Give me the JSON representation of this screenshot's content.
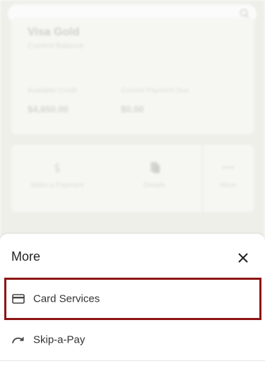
{
  "background": {
    "search": {
      "icon": "search-icon"
    },
    "account_card": {
      "name": "Visa Gold",
      "subtitle": "Current Balance",
      "available_credit_label": "Available Credit",
      "available_credit_value": "$4,650.00",
      "payment_due_label": "Current Payment Due",
      "payment_due_value": "$0.00"
    },
    "actions": [
      {
        "label": "Make a Payment",
        "icon": "dollar-icon"
      },
      {
        "label": "Details",
        "icon": "document-icon"
      },
      {
        "label": "More",
        "icon": "ellipsis-icon"
      }
    ]
  },
  "sheet": {
    "title": "More",
    "close_icon": "close-icon",
    "items": [
      {
        "label": "Card Services",
        "icon": "credit-card-icon"
      },
      {
        "label": "Skip-a-Pay",
        "icon": "redo-arrow-icon"
      }
    ],
    "highlight_color": "#8e1515"
  }
}
